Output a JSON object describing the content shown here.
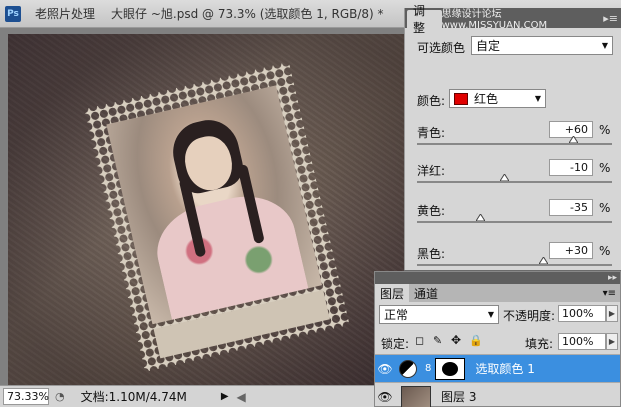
{
  "app": {
    "logo_text": "Ps"
  },
  "tabs": [
    {
      "label": "老照片处理"
    },
    {
      "label": "大眼仔 ~旭.psd @ 73.3% (选取颜色 1, RGB/8) *"
    }
  ],
  "adjustments": {
    "tab_label": "调整",
    "watermark": "思缘设计论坛  www.MISSYUAN.COM",
    "preset_label": "可选颜色",
    "preset_value": "自定",
    "colors_label": "颜色:",
    "colors_value": "红色",
    "colors_swatch": "#e00000",
    "sliders": [
      {
        "label": "青色:",
        "value": "+60",
        "unit": "%",
        "level": 0.8
      },
      {
        "label": "洋红:",
        "value": "-10",
        "unit": "%",
        "level": 0.45
      },
      {
        "label": "黄色:",
        "value": "-35",
        "unit": "%",
        "level": 0.325
      },
      {
        "label": "黑色:",
        "value": "+30",
        "unit": "%",
        "level": 0.65
      }
    ]
  },
  "status": {
    "zoom": "73.33%",
    "doc_info": "文档:1.10M/4.74M"
  },
  "layers": {
    "tab_layers": "图层",
    "tab_channels": "通道",
    "blend_mode": "正常",
    "opacity_label": "不透明度:",
    "opacity_value": "100%",
    "lock_label": "锁定:",
    "fill_label": "填充:",
    "fill_value": "100%",
    "items": [
      {
        "name": "选取颜色 1"
      },
      {
        "name": "图层 3"
      }
    ]
  }
}
